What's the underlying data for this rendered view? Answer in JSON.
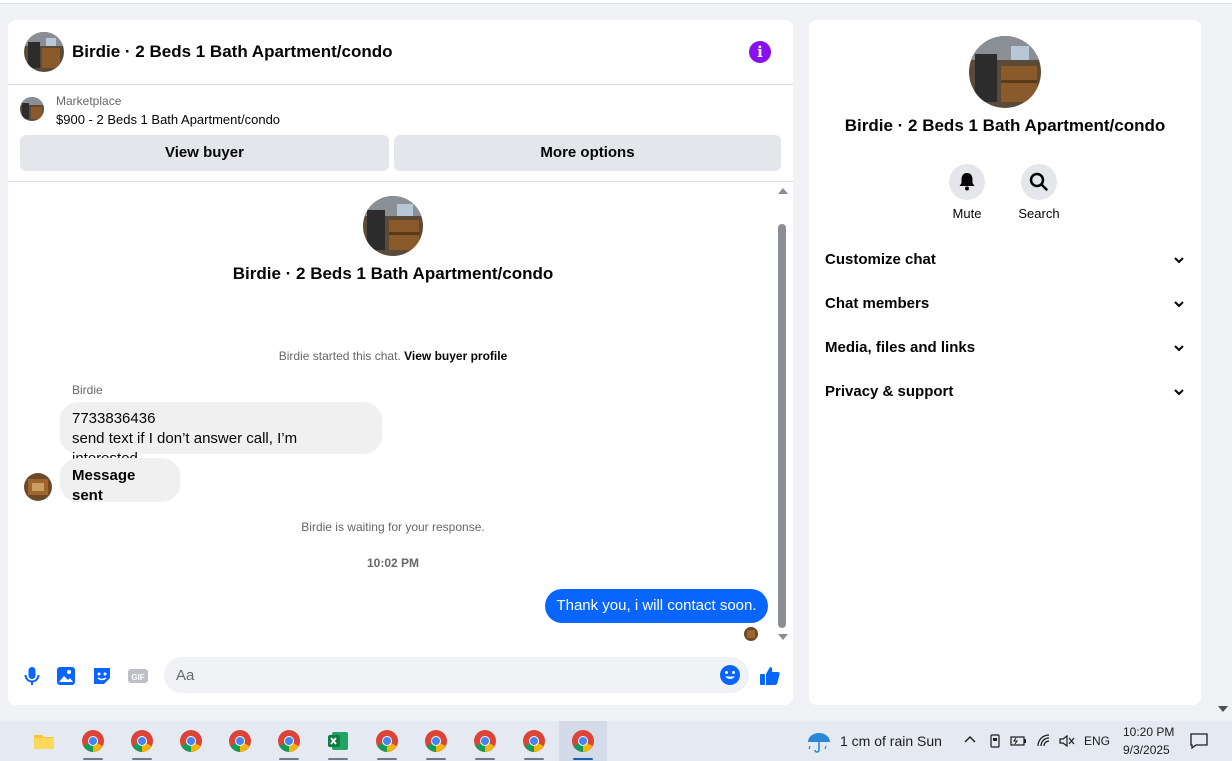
{
  "chat": {
    "title": "Birdie · 2 Beds 1 Bath Apartment/condo",
    "marketplace_label": "Marketplace",
    "listing": "$900 - 2 Beds 1 Bath Apartment/condo",
    "view_buyer": "View buyer",
    "more_options": "More options",
    "conversation_title": "Birdie · 2 Beds 1 Bath Apartment/condo",
    "started_text": "Birdie started this chat.",
    "view_buyer_profile": "View buyer profile",
    "sender": "Birdie",
    "messages_in": [
      {
        "line1": "7733836436",
        "line2": "send text if I don’t answer call, I’m interested."
      },
      {
        "line1": "Message sent"
      }
    ],
    "waiting": "Birdie is waiting for your response.",
    "timestamp": "10:02 PM",
    "message_out": "Thank you, i will contact soon.",
    "input_placeholder": "Aa"
  },
  "info": {
    "title": "Birdie · 2 Beds 1 Bath Apartment/condo",
    "mute": "Mute",
    "search": "Search",
    "sections": [
      "Customize chat",
      "Chat members",
      "Media, files and links",
      "Privacy & support"
    ]
  },
  "taskbar": {
    "weather": "1 cm of rain Sun",
    "lang": "ENG",
    "time": "10:20 PM",
    "date": "9/3/2025"
  },
  "colors": {
    "accent": "#0866ff",
    "info": "#8a0ff0"
  }
}
